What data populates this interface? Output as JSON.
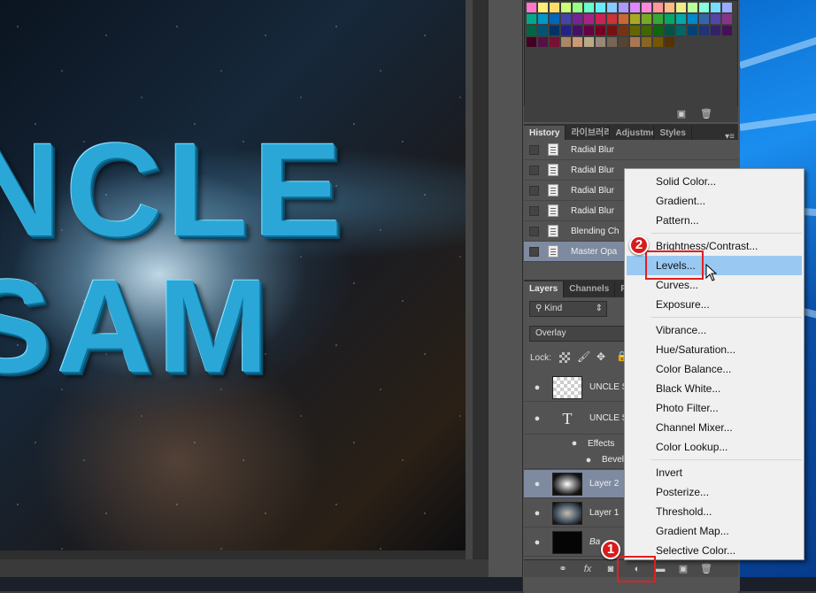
{
  "canvas": {
    "line1": "NCLE",
    "line2": "SAM"
  },
  "history": {
    "tabs": [
      "History",
      "라이브러리",
      "Adjustme",
      "Styles"
    ],
    "items": [
      {
        "label": "Radial Blur",
        "selected": false
      },
      {
        "label": "Radial Blur",
        "selected": false
      },
      {
        "label": "Radial Blur",
        "selected": false
      },
      {
        "label": "Radial Blur",
        "selected": false
      },
      {
        "label": "Blending Ch",
        "selected": false
      },
      {
        "label": "Master Opa",
        "selected": true
      }
    ]
  },
  "layers": {
    "tabs": [
      "Layers",
      "Channels",
      "P"
    ],
    "filter_kind": "Kind",
    "blend_mode": "Overlay",
    "lock_label": "Lock:",
    "rows": [
      {
        "name": "UNCLE S",
        "type": "pixel",
        "selected": false
      },
      {
        "name": "UNCLE S",
        "type": "text",
        "selected": false
      },
      {
        "name": "Effects",
        "type": "effects",
        "selected": false
      },
      {
        "name": "Bevel",
        "type": "effect-item",
        "selected": false
      },
      {
        "name": "Layer 2",
        "type": "pixel",
        "selected": true
      },
      {
        "name": "Layer 1",
        "type": "pixel",
        "selected": false
      },
      {
        "name": "Ba",
        "type": "background",
        "selected": false
      }
    ],
    "footer_fx": "fx"
  },
  "menu": {
    "groups": [
      [
        "Solid Color...",
        "Gradient...",
        "Pattern..."
      ],
      [
        "Brightness/Contrast...",
        "Levels...",
        "Curves...",
        "Exposure..."
      ],
      [
        "Vibrance...",
        "Hue/Saturation...",
        "Color Balance...",
        "Black  White...",
        "Photo Filter...",
        "Channel Mixer...",
        "Color Lookup..."
      ],
      [
        "Invert",
        "Posterize...",
        "Threshold...",
        "Gradient Map...",
        "Selective Color..."
      ]
    ],
    "hovered": "Levels..."
  },
  "annotations": {
    "step1": "1",
    "step2": "2"
  },
  "colors": {
    "highlight": "#e02020",
    "menu_hover": "#99c9f3",
    "selected_row": "#7e8aa0"
  }
}
